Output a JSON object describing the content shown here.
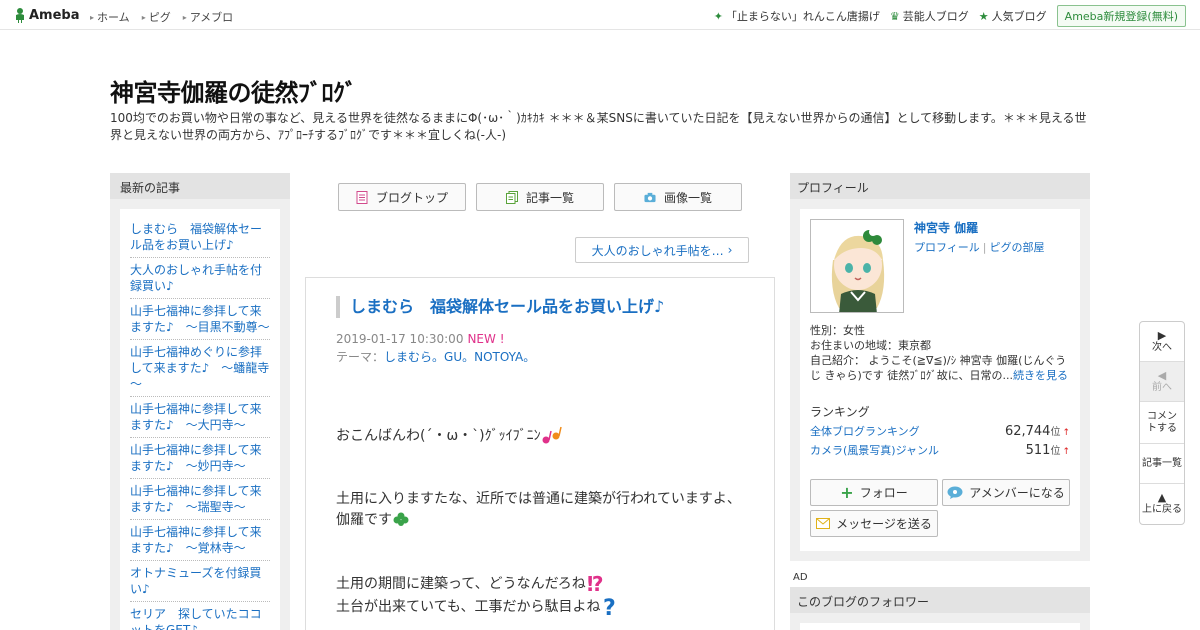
{
  "topbar": {
    "logo_text": "Ameba",
    "nav": [
      "ホーム",
      "ピグ",
      "アメブロ"
    ],
    "links": [
      {
        "icon": "sparkle-icon",
        "label": "「止まらない」れんこん唐揚げ"
      },
      {
        "icon": "crown-icon",
        "label": "芸能人ブログ"
      },
      {
        "icon": "star-icon",
        "label": "人気ブログ"
      }
    ],
    "signup_label": "Ameba新規登録(無料)",
    "accent": "#2d8c3c"
  },
  "header": {
    "title": "神宮寺伽羅の徒然ﾌﾞﾛｸﾞ",
    "description": "100均でのお買い物や日常の事など、見える世界を徒然なるままにΦ(･ω･｀)ｶｷｶｷ ＊＊＊＆某SNSに書いていた日記を【見えない世界からの通信】として移動します。＊＊＊見える世界と見えない世界の両方から、ｱﾌﾟﾛｰﾁするﾌﾞﾛｸﾞです＊＊＊宜しくね(-人-)"
  },
  "left": {
    "heading": "最新の記事",
    "articles": [
      "しまむら　福袋解体セール品をお買い上げ♪",
      "大人のおしゃれ手帖を付録買い♪",
      "山手七福神に参拝して来ますた♪　～目黒不動尊～",
      "山手七福神めぐりに参拝して来ますた♪　～蟠龍寺～",
      "山手七福神に参拝して来ますた♪　～大円寺～",
      "山手七福神に参拝して来ますた♪　～妙円寺～",
      "山手七福神に参拝して来ますた♪　～瑞聖寺～",
      "山手七福神に参拝して来ますた♪　～覚林寺～",
      "オトナミューズを付録買い♪",
      "セリア　探していたココットをGET♪"
    ]
  },
  "center": {
    "buttons": [
      {
        "icon": "document-icon",
        "label": "ブログトップ"
      },
      {
        "icon": "list-icon",
        "label": "記事一覧"
      },
      {
        "icon": "camera-icon",
        "label": "画像一覧"
      }
    ],
    "next_article": "大人のおしゃれ手帖を…",
    "article": {
      "title": "しまむら　福袋解体セール品をお買い上げ♪",
      "datetime": "2019-01-17 10:30:00",
      "new_badge": "NEW !",
      "theme_label": "テーマ：",
      "theme": "しまむら。GU。NOTOYA。",
      "body": [
        "おこんばんわ(´・ω・`)ｸﾞｯｲﾌﾞﾆﾝ",
        "土用に入りますたな、近所では普通に建築が行われていますよ、",
        "伽羅です",
        "土用の期間に建築って、どうなんだろね",
        "土台が出来ていても、工事だから駄目よね"
      ]
    }
  },
  "right": {
    "heading": "プロフィール",
    "name": "神宮寺 伽羅",
    "links": [
      "プロフィール",
      "ピグの部屋"
    ],
    "gender": "性別：女性",
    "area": "お住まいの地域：東京都",
    "intro": "自己紹介： ようこそ(≧∇≦)/ｼ 神宮寺 伽羅(じんぐうじ きゃら)です 徒然ﾌﾞﾛｸﾞ故に、日常の...",
    "more": "続きを見る",
    "ranking_title": "ランキング",
    "rankings": [
      {
        "label": "全体ブログランキング",
        "value": "62,744",
        "unit": "位",
        "arrow": "↑"
      },
      {
        "label": "カメラ(風景写真)ジャンル",
        "value": "511",
        "unit": "位",
        "arrow": "↑"
      }
    ],
    "follow_label": "フォロー",
    "amember_label": "アメンバーになる",
    "message_label": "メッセージを送る",
    "ad_label": "AD",
    "followers_heading": "このブログのフォロワー"
  },
  "sidenav": [
    {
      "icon": "next-triangle-icon",
      "label": "次へ",
      "enabled": true
    },
    {
      "icon": "prev-triangle-icon",
      "label": "前へ",
      "enabled": false
    },
    {
      "icon": "",
      "label": "コメントする",
      "enabled": true
    },
    {
      "icon": "",
      "label": "記事一覧",
      "enabled": true
    },
    {
      "icon": "up-triangle-icon",
      "label": "上に戻る",
      "enabled": true
    }
  ]
}
